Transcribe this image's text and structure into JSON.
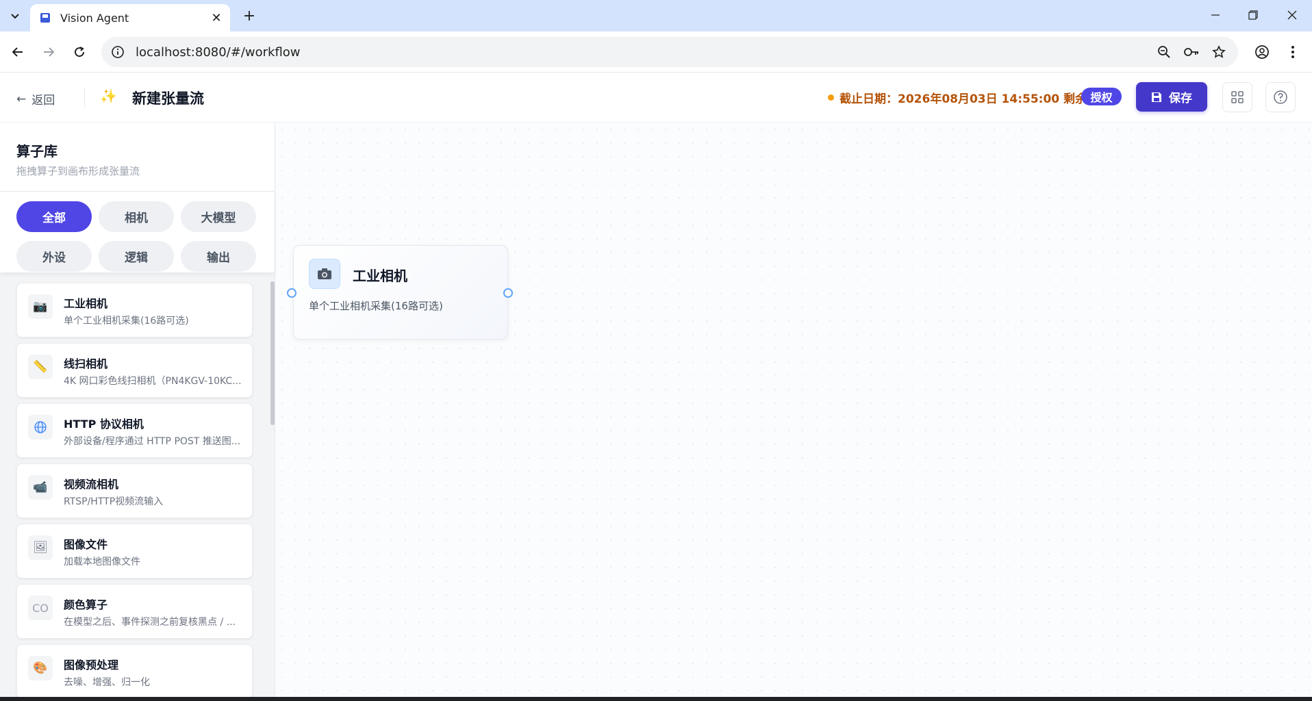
{
  "browser": {
    "tab_title": "Vision Agent",
    "url": "localhost:8080/#/workflow"
  },
  "header": {
    "back_label": "返回",
    "flow_title": "新建张量流",
    "deadline_text": "截止日期：2026年08月03日 14:55:00 剩余1天",
    "auth_label": "授权",
    "save_label": "保存"
  },
  "library": {
    "title": "算子库",
    "subtitle": "拖拽算子到画布形成张量流",
    "filters": [
      "全部",
      "相机",
      "大模型",
      "外设",
      "逻辑",
      "输出"
    ],
    "active_filter": "全部",
    "operators": [
      {
        "name": "工业相机",
        "desc": "单个工业相机采集(16路可选)",
        "icon": "camera-icon"
      },
      {
        "name": "线扫相机",
        "desc": "4K 网口彩色线扫相机（PN4KGV-10KC...",
        "icon": "ruler-icon"
      },
      {
        "name": "HTTP 协议相机",
        "desc": "外部设备/程序通过 HTTP POST 推送图...",
        "icon": "globe-icon"
      },
      {
        "name": "视频流相机",
        "desc": "RTSP/HTTP视频流输入",
        "icon": "video-camera-icon"
      },
      {
        "name": "图像文件",
        "desc": "加载本地图像文件",
        "icon": "image-icon"
      },
      {
        "name": "颜色算子",
        "desc": "在模型之后、事件探测之前复核黑点 / ...",
        "icon_text": "CO"
      },
      {
        "name": "图像预处理",
        "desc": "去噪、增强、归一化",
        "icon": "palette-icon"
      }
    ]
  },
  "canvas": {
    "node": {
      "name": "工业相机",
      "desc": "单个工业相机采集(16路可选)",
      "icon": "camera-icon"
    }
  }
}
